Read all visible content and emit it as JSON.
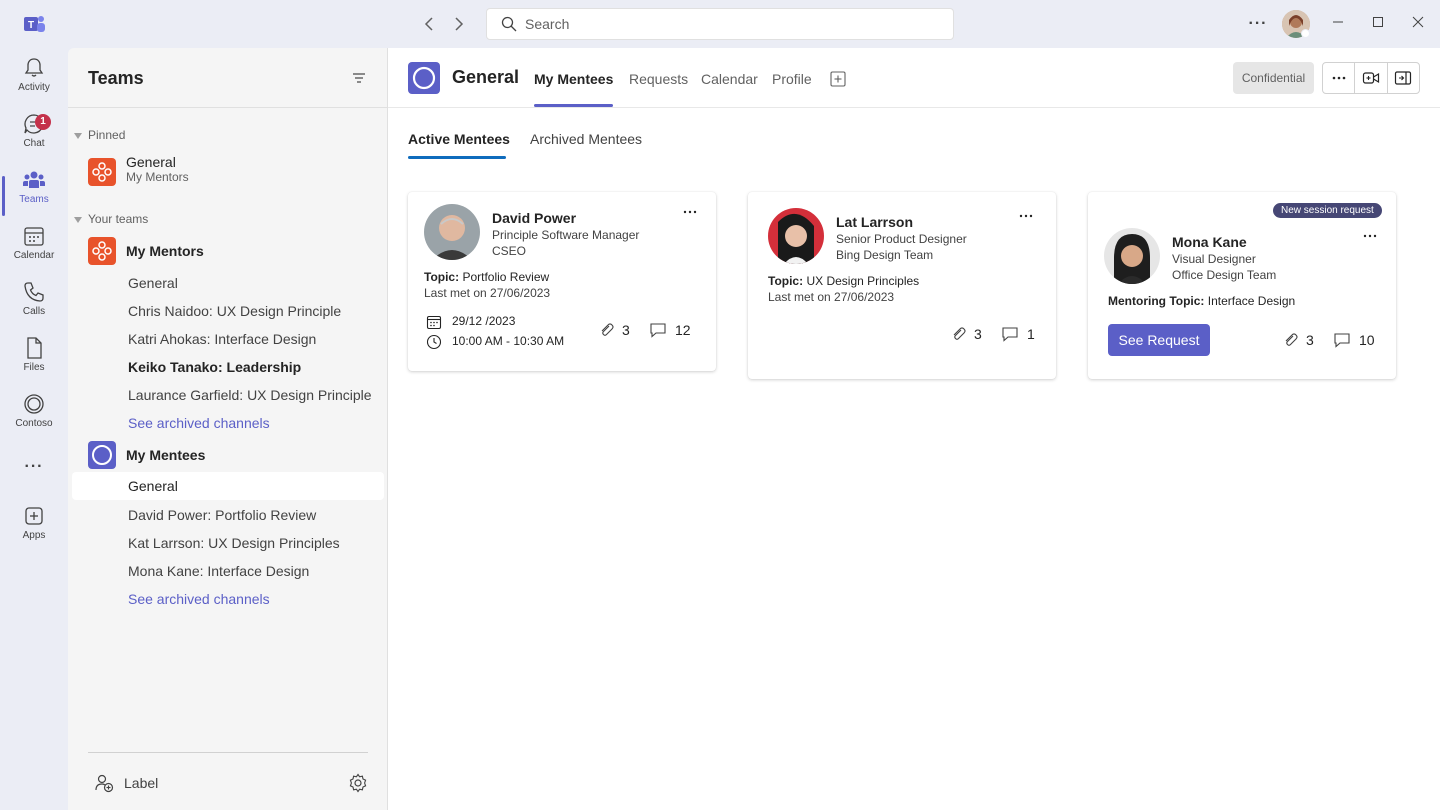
{
  "titlebar": {
    "search_placeholder": "Search",
    "more_label": "···"
  },
  "rail": {
    "items": [
      {
        "label": "Activity",
        "icon": "bell-icon"
      },
      {
        "label": "Chat",
        "icon": "chat-icon",
        "badge": "1"
      },
      {
        "label": "Teams",
        "icon": "teams-icon",
        "active": true
      },
      {
        "label": "Calendar",
        "icon": "calendar-icon"
      },
      {
        "label": "Calls",
        "icon": "phone-icon"
      },
      {
        "label": "Files",
        "icon": "file-icon"
      },
      {
        "label": "Contoso",
        "icon": "contoso-icon"
      },
      {
        "label": "Apps",
        "icon": "add-app-icon"
      }
    ],
    "more": "···"
  },
  "panel": {
    "title": "Teams",
    "pinned_header": "Pinned",
    "pinned": {
      "name": "General",
      "sub": "My Mentors"
    },
    "your_teams_header": "Your teams",
    "teams": [
      {
        "name": "My Mentors",
        "channels": [
          {
            "label": "General"
          },
          {
            "label": "Chris Naidoo: UX Design Principle"
          },
          {
            "label": "Katri Ahokas: Interface Design"
          },
          {
            "label": "Keiko Tanako: Leadership"
          },
          {
            "label": "Laurance Garfield: UX Design Principle"
          },
          {
            "label": "See archived channels"
          }
        ]
      },
      {
        "name": "My Mentees",
        "channels": [
          {
            "label": "General"
          },
          {
            "label": "David Power: Portfolio Review"
          },
          {
            "label": "Kat Larrson: UX Design Principles"
          },
          {
            "label": "Mona Kane: Interface Design"
          },
          {
            "label": "See archived channels"
          }
        ]
      }
    ],
    "footer_label": "Label"
  },
  "main": {
    "channel_title": "General",
    "tabs": [
      {
        "label": "My Mentees"
      },
      {
        "label": "Requests"
      },
      {
        "label": "Calendar"
      },
      {
        "label": "Profile"
      }
    ],
    "confidential": "Confidential",
    "subtabs": [
      {
        "label": "Active Mentees"
      },
      {
        "label": "Archived Mentees"
      }
    ],
    "cards": [
      {
        "name": "David Power",
        "title": "Principle Software Manager",
        "org": "CSEO",
        "topic_label": "Topic:",
        "topic": "Portfolio Review",
        "last_met": "Last met on 27/06/2023",
        "date": "29/12 /2023",
        "time": "10:00 AM - 10:30 AM",
        "attachments": "3",
        "comments": "12"
      },
      {
        "name": "Lat Larrson",
        "title": "Senior Product Designer",
        "org": "Bing Design Team",
        "topic_label": "Topic:",
        "topic": "UX Design Principles",
        "last_met": "Last met on 27/06/2023",
        "attachments": "3",
        "comments": "1"
      },
      {
        "badge": "New session request",
        "name": "Mona Kane",
        "title": "Visual Designer",
        "org": "Office Design Team",
        "topic_label": "Mentoring Topic:",
        "topic": "Interface Design",
        "button": "See Request",
        "attachments": "3",
        "comments": "10"
      }
    ]
  },
  "colors": {
    "brand": "#5b5fc7",
    "orange_team": "#e8532b",
    "badge_red": "#c4314b",
    "request_badge": "#464775"
  }
}
